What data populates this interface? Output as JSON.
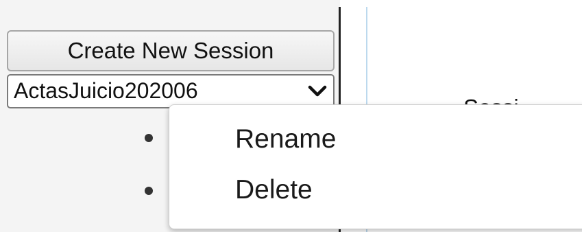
{
  "sidebar": {
    "create_button_label": "Create New Session",
    "session_select": {
      "selected_value": "ActasJuicio202006",
      "dropdown_icon": "chevron-down-icon"
    },
    "session_actions_bullets": 2
  },
  "main": {
    "partial_text": "Sessi"
  },
  "context_menu": {
    "items": [
      {
        "label": "Rename"
      },
      {
        "label": "Delete"
      }
    ]
  },
  "colors": {
    "panel_background": "#f4f4f4",
    "divider": "#222222",
    "accent_line": "#bcd9ee",
    "menu_background": "#ffffff"
  }
}
